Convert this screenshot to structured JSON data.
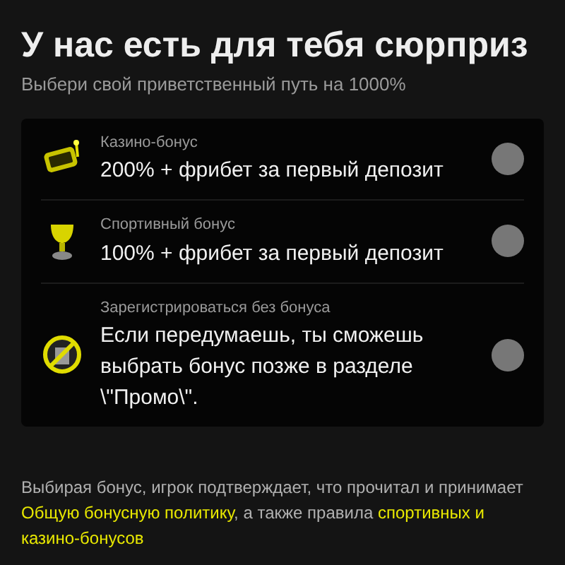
{
  "title": "У нас есть для тебя сюрприз",
  "subtitle": "Выбери свой приветственный путь на 1000%",
  "options": [
    {
      "kind": "casino",
      "label": "Казино-бонус",
      "description": "200% + фрибет за первый депозит",
      "selected": false
    },
    {
      "kind": "sport",
      "label": "Спортивный бонус",
      "description": "100% + фрибет за первый депозит",
      "selected": false
    },
    {
      "kind": "none",
      "label": "Зарегистрироваться без бонуса",
      "description": "Если передумаешь, ты сможешь выбрать бонус позже в разделе \\\"Промо\\\".",
      "selected": false
    }
  ],
  "footer": [
    {
      "kind": "text",
      "text": "Выбирая бонус, игрок подтверждает, что прочитал и принимает "
    },
    {
      "kind": "link",
      "text": "Общую бонусную политику"
    },
    {
      "kind": "text",
      "text": ", а также правила "
    },
    {
      "kind": "link",
      "text": "спортивных и"
    },
    {
      "kind": "link",
      "text": "казино-бонусов"
    }
  ]
}
